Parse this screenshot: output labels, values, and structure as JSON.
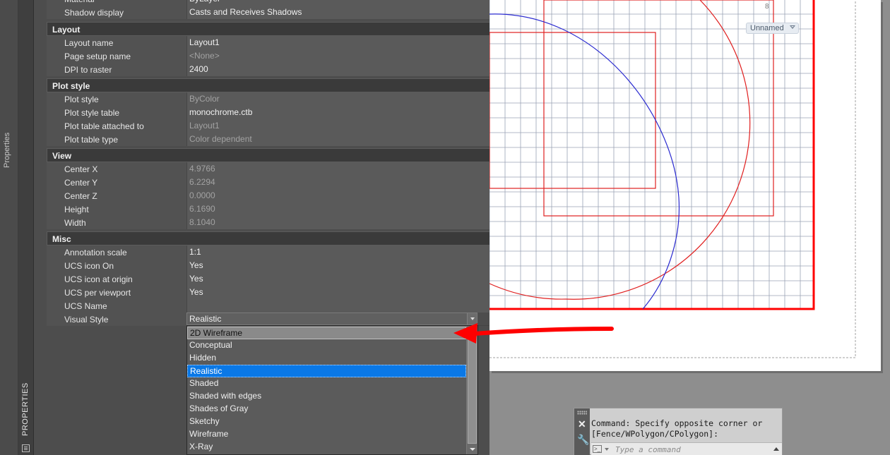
{
  "sidebar": {
    "outer_label": "Properties",
    "palette_label": "PROPERTIES"
  },
  "top_rows": [
    {
      "name": "Material",
      "value": "ByLayer",
      "readonly": false
    },
    {
      "name": "Shadow display",
      "value": "Casts and Receives Shadows",
      "readonly": false
    }
  ],
  "sections": [
    {
      "title": "Layout",
      "toggle": "−",
      "rows": [
        {
          "name": "Layout name",
          "value": "Layout1",
          "readonly": false
        },
        {
          "name": "Page setup name",
          "value": "<None>",
          "readonly": true
        },
        {
          "name": "DPI to raster",
          "value": "2400",
          "readonly": false
        }
      ]
    },
    {
      "title": "Plot style",
      "toggle": "−",
      "rows": [
        {
          "name": "Plot style",
          "value": "ByColor",
          "readonly": true
        },
        {
          "name": "Plot style table",
          "value": "monochrome.ctb",
          "readonly": false
        },
        {
          "name": "Plot table attached to",
          "value": "Layout1",
          "readonly": true
        },
        {
          "name": "Plot table type",
          "value": "Color dependent",
          "readonly": true
        }
      ]
    },
    {
      "title": "View",
      "toggle": "−",
      "rows": [
        {
          "name": "Center X",
          "value": "4.9766",
          "readonly": true
        },
        {
          "name": "Center Y",
          "value": "6.2294",
          "readonly": true
        },
        {
          "name": "Center Z",
          "value": "0.0000",
          "readonly": true
        },
        {
          "name": "Height",
          "value": "6.1690",
          "readonly": true
        },
        {
          "name": "Width",
          "value": "8.1040",
          "readonly": true
        }
      ]
    },
    {
      "title": "Misc",
      "toggle": "−",
      "rows": [
        {
          "name": "Annotation scale",
          "value": "1:1",
          "readonly": false
        },
        {
          "name": "UCS icon On",
          "value": "Yes",
          "readonly": false
        },
        {
          "name": "UCS icon at origin",
          "value": "Yes",
          "readonly": false
        },
        {
          "name": "UCS per viewport",
          "value": "Yes",
          "readonly": false
        },
        {
          "name": "UCS Name",
          "value": "",
          "readonly": false
        }
      ]
    }
  ],
  "visual_style": {
    "label": "Visual Style",
    "value": "Realistic",
    "options": [
      "2D Wireframe",
      "Conceptual",
      "Hidden",
      "Realistic",
      "Shaded",
      "Shaded with edges",
      "Shades of Gray",
      "Sketchy",
      "Wireframe",
      "X-Ray"
    ],
    "hovered_option": "2D Wireframe",
    "selected_option": "Realistic"
  },
  "canvas": {
    "viewport_label": "Unnamed",
    "viewport_number": "8"
  },
  "command_line": {
    "history": [
      "Command: Specify opposite corner or",
      "[Fence/WPolygon/CPolygon]:"
    ],
    "placeholder": "Type a command"
  },
  "colors": {
    "panel_bg": "#4d4d4d",
    "selection": "#0a78e6",
    "annotation_red": "#ff0000",
    "drawing_red": "#e02020",
    "drawing_blue": "#2a2ad0",
    "grid": "#9aa3b5"
  }
}
